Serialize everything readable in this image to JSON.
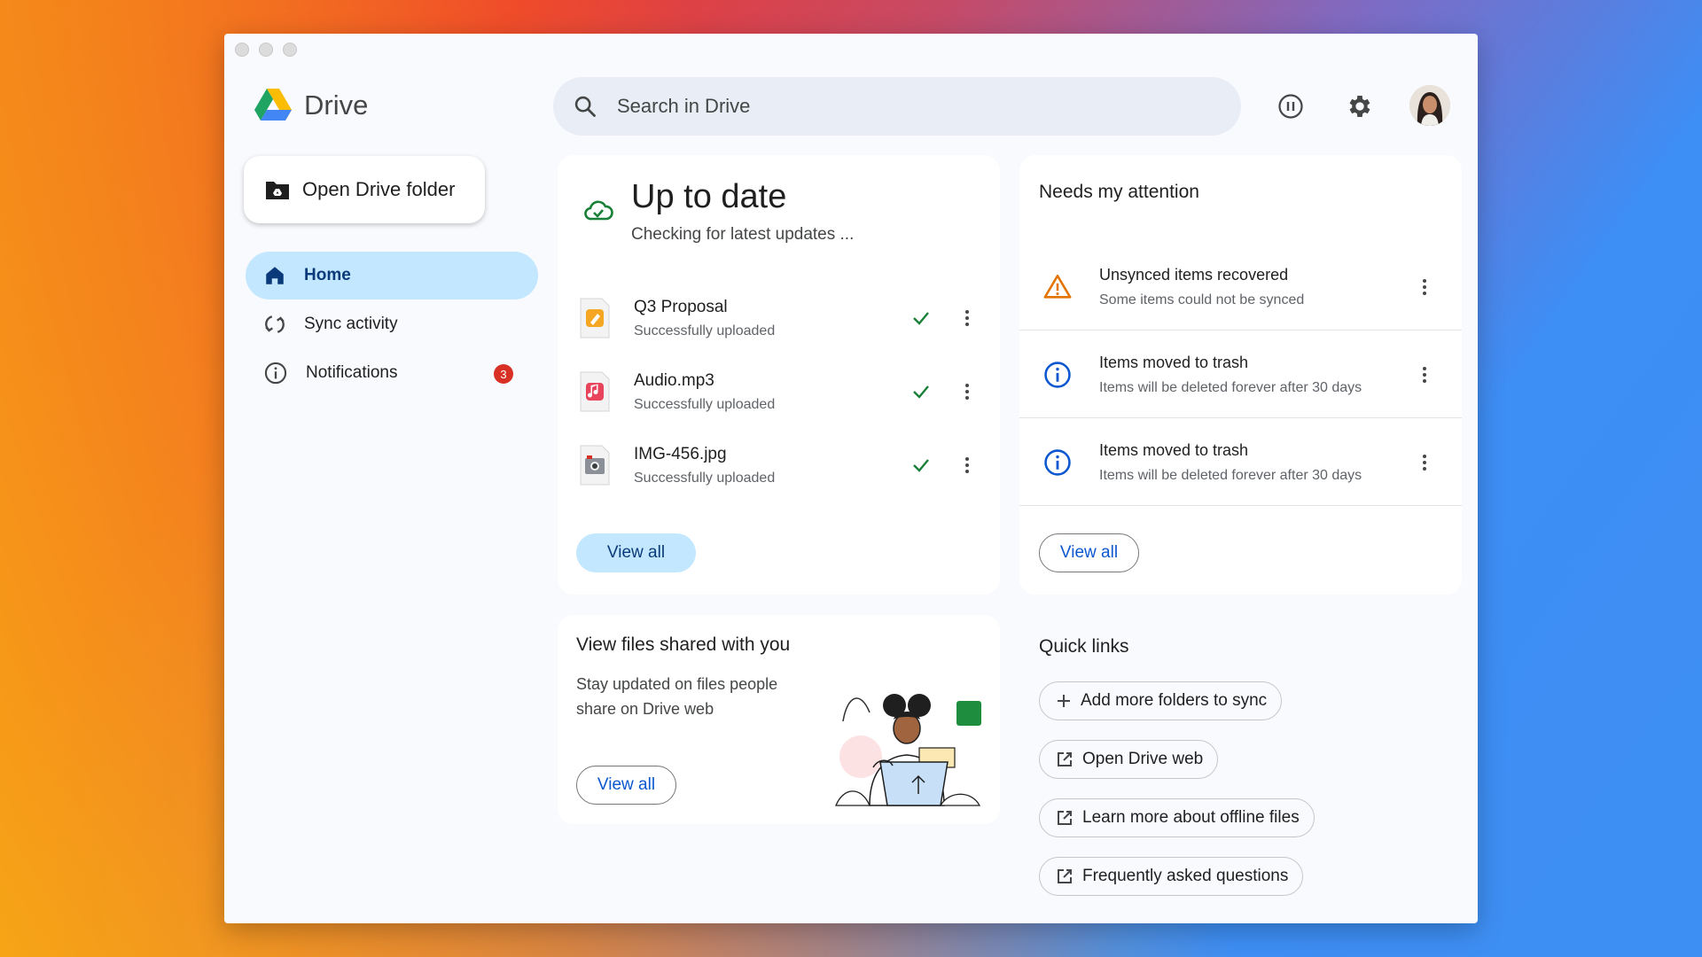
{
  "app": {
    "name": "Drive"
  },
  "search": {
    "placeholder": "Search in Drive"
  },
  "sidebar": {
    "open_folder_label": "Open Drive folder",
    "items": [
      {
        "label": "Home",
        "icon": "home-icon",
        "active": true
      },
      {
        "label": "Sync activity",
        "icon": "sync-icon"
      },
      {
        "label": "Notifications",
        "icon": "info-icon",
        "badge": "3"
      }
    ]
  },
  "sync": {
    "title": "Up to date",
    "subtitle": "Checking for latest updates ...",
    "files": [
      {
        "name": "Q3 Proposal",
        "status": "Successfully uploaded",
        "type": "pages"
      },
      {
        "name": "Audio.mp3",
        "status": "Successfully uploaded",
        "type": "audio"
      },
      {
        "name": "IMG-456.jpg",
        "status": "Successfully uploaded",
        "type": "image"
      }
    ],
    "view_all": "View all"
  },
  "attention": {
    "title": "Needs my attention",
    "items": [
      {
        "title": "Unsynced items recovered",
        "desc": "Some items could not be synced",
        "icon": "warning-icon"
      },
      {
        "title": "Items moved to trash",
        "desc": "Items will be deleted forever after 30 days",
        "icon": "info-icon"
      },
      {
        "title": "Items moved to trash",
        "desc": "Items will be deleted forever after 30 days",
        "icon": "info-icon"
      }
    ],
    "view_all": "View all"
  },
  "shared": {
    "title": "View files shared with you",
    "desc": "Stay updated on files people share on Drive web",
    "view_all": "View all"
  },
  "quick_links": {
    "title": "Quick links",
    "items": [
      {
        "label": "Add more folders to sync",
        "icon": "plus-icon"
      },
      {
        "label": "Open Drive web",
        "icon": "open-external-icon"
      },
      {
        "label": "Learn more about offline files",
        "icon": "open-external-icon"
      },
      {
        "label": "Frequently asked questions",
        "icon": "open-external-icon"
      }
    ]
  },
  "colors": {
    "accent": "#0b57d0",
    "active_nav": "#c2e7ff",
    "badge": "#d93025",
    "check": "#188038",
    "warning": "#e37400"
  }
}
